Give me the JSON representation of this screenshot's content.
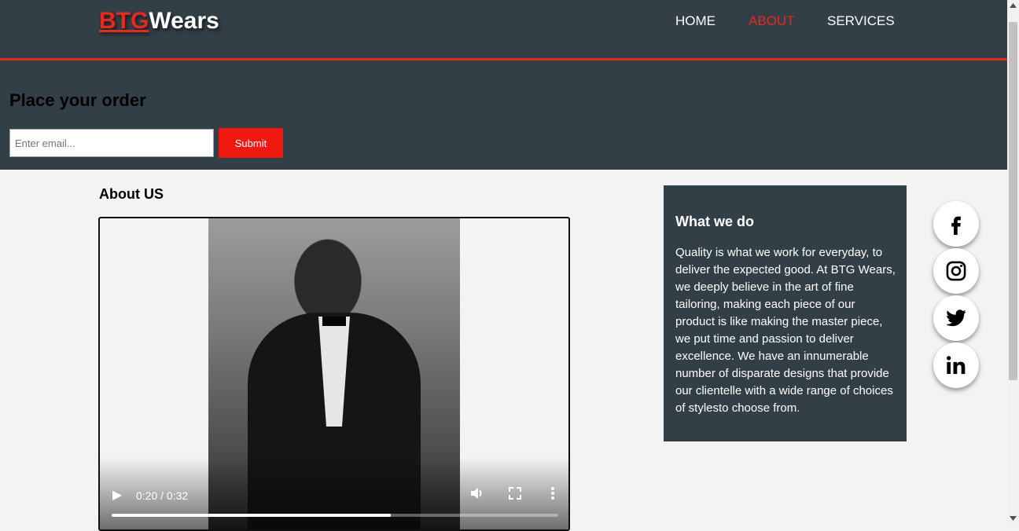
{
  "header": {
    "logo_red": "BTG",
    "logo_white": "Wears",
    "nav": [
      {
        "label": "HOME"
      },
      {
        "label": "ABOUT"
      },
      {
        "label": "SERVICES"
      }
    ],
    "active_nav": "ABOUT"
  },
  "order": {
    "title": "Place your order",
    "email_placeholder": "Enter email...",
    "submit_label": "Submit"
  },
  "about": {
    "title": "About US",
    "video": {
      "time": "0:20 / 0:32",
      "progress": 0.625
    }
  },
  "what_we_do": {
    "title": "What we do",
    "text": "Quality is what we work for everyday, to deliver the expected good. At BTG Wears, we deeply believe in the art of fine tailoring, making each piece of our product is like making the master piece, we put time and passion to deliver excellence. We have an innumerable number of disparate designs that provide our clientelle with a wide range of choices of stylesto choose from."
  },
  "social": [
    "facebook-icon",
    "instagram-icon",
    "twitter-icon",
    "linkedin-icon"
  ],
  "colors": {
    "accent": "#e52a20",
    "panel": "#323f46",
    "background": "#f3f3f3"
  }
}
